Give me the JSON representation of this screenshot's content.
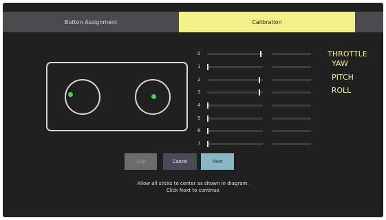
{
  "tabs": [
    {
      "label": "Button Assignment",
      "active": false
    },
    {
      "label": "Calibration",
      "active": true
    }
  ],
  "channels": [
    {
      "label": "0",
      "value": 0.52
    },
    {
      "label": "1",
      "value": 0.0
    },
    {
      "label": "2",
      "value": 0.5
    },
    {
      "label": "3",
      "value": 0.5
    },
    {
      "label": "4",
      "value": 0.0
    },
    {
      "label": "5",
      "value": 0.0
    },
    {
      "label": "6",
      "value": 0.0
    },
    {
      "label": "7",
      "value": 0.0
    }
  ],
  "axes": {
    "throttle": "THROTTLE",
    "yaw": "YAW",
    "pitch": "PITCH",
    "roll": "ROLL"
  },
  "buttons": {
    "skip": "Skip",
    "cancel": "Cancel",
    "next": "Next"
  },
  "instructions": {
    "line1": "Allow all sticks to center as shown in diagram.",
    "line2": "Click Next to continue"
  },
  "colors": {
    "accent": "#f3f088",
    "background": "#202020",
    "stick_dot": "#33dd44",
    "next_button": "#87b7c2"
  }
}
